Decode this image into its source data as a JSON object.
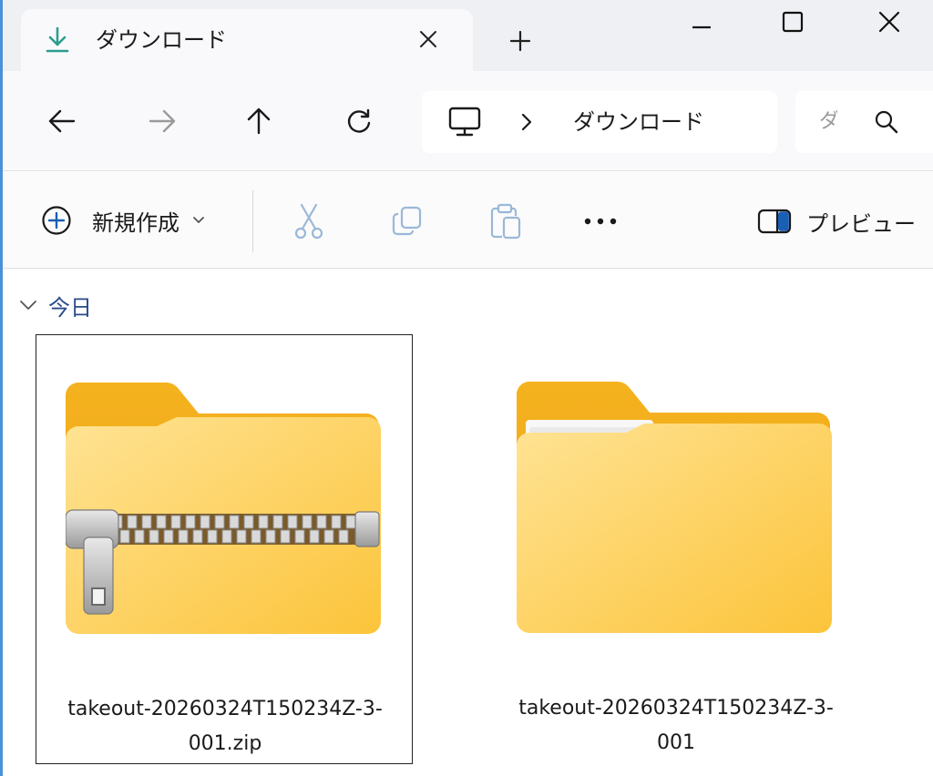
{
  "window": {
    "tab_title": "ダウンロード",
    "tab_icon": "download-icon",
    "new_tab_symbol": "+",
    "close_tab_symbol": "✕"
  },
  "nav": {
    "back_icon": "arrow-left-icon",
    "forward_icon": "arrow-right-icon",
    "up_icon": "arrow-up-icon",
    "refresh_icon": "refresh-icon",
    "address": {
      "root_icon": "this-pc-icon",
      "separator_icon": "chevron-right-icon",
      "crumb": "ダウンロード"
    },
    "search": {
      "placeholder": "ダウンロードの検索",
      "icon": "search-icon"
    }
  },
  "commands": {
    "new_label": "新規作成",
    "cut_icon": "scissors-icon",
    "copy_icon": "copy-icon",
    "paste_icon": "paste-icon",
    "more_icon": "more-icon",
    "preview_label": "プレビュー"
  },
  "content": {
    "group_label": "今日",
    "items": [
      {
        "name_line1": "takeout-20260324T150234Z-3-",
        "name_line2": "001.zip",
        "type": "zip-folder-icon",
        "selected": true
      },
      {
        "name_line1": "takeout-20260324T150234Z-3-",
        "name_line2": "001",
        "type": "folder-icon",
        "selected": false
      }
    ]
  },
  "colors": {
    "accent": "#2a9d8f",
    "folder_back": "#f5b21f",
    "folder_front": "#ffd86b",
    "group_header": "#2a4a8a",
    "command_icon_disabled": "#9ab8d8"
  }
}
